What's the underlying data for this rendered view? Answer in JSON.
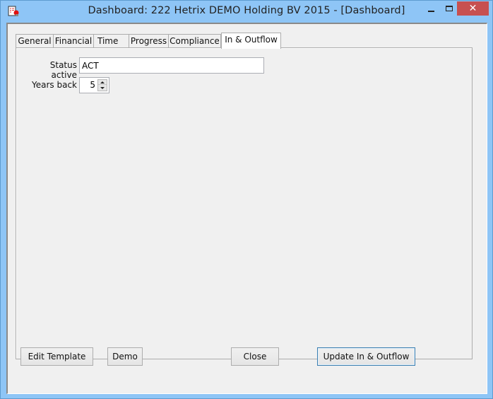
{
  "window": {
    "title": "Dashboard: 222 Hetrix DEMO Holding BV 2015 - [Dashboard]",
    "icon": "report-icon",
    "controls": {
      "minimize": "minimize-icon",
      "maximize": "maximize-icon",
      "close_glyph": "✕"
    }
  },
  "tabs": [
    {
      "label": "General",
      "active": false
    },
    {
      "label": "Financial",
      "active": false
    },
    {
      "label": "Time",
      "active": false
    },
    {
      "label": "Progress",
      "active": false
    },
    {
      "label": "Compliance",
      "active": false
    },
    {
      "label": "In & Outflow",
      "active": true
    }
  ],
  "form": {
    "status_active": {
      "label": "Status active",
      "value": "ACT"
    },
    "years_back": {
      "label": "Years back",
      "value": "5"
    }
  },
  "buttons": {
    "edit_template": "Edit Template",
    "demo": "Demo",
    "close": "Close",
    "update": "Update In & Outflow"
  },
  "colors": {
    "titlebar": "#8ec5f6",
    "close_button": "#c75050",
    "default_button_border": "#3c7fb1"
  }
}
